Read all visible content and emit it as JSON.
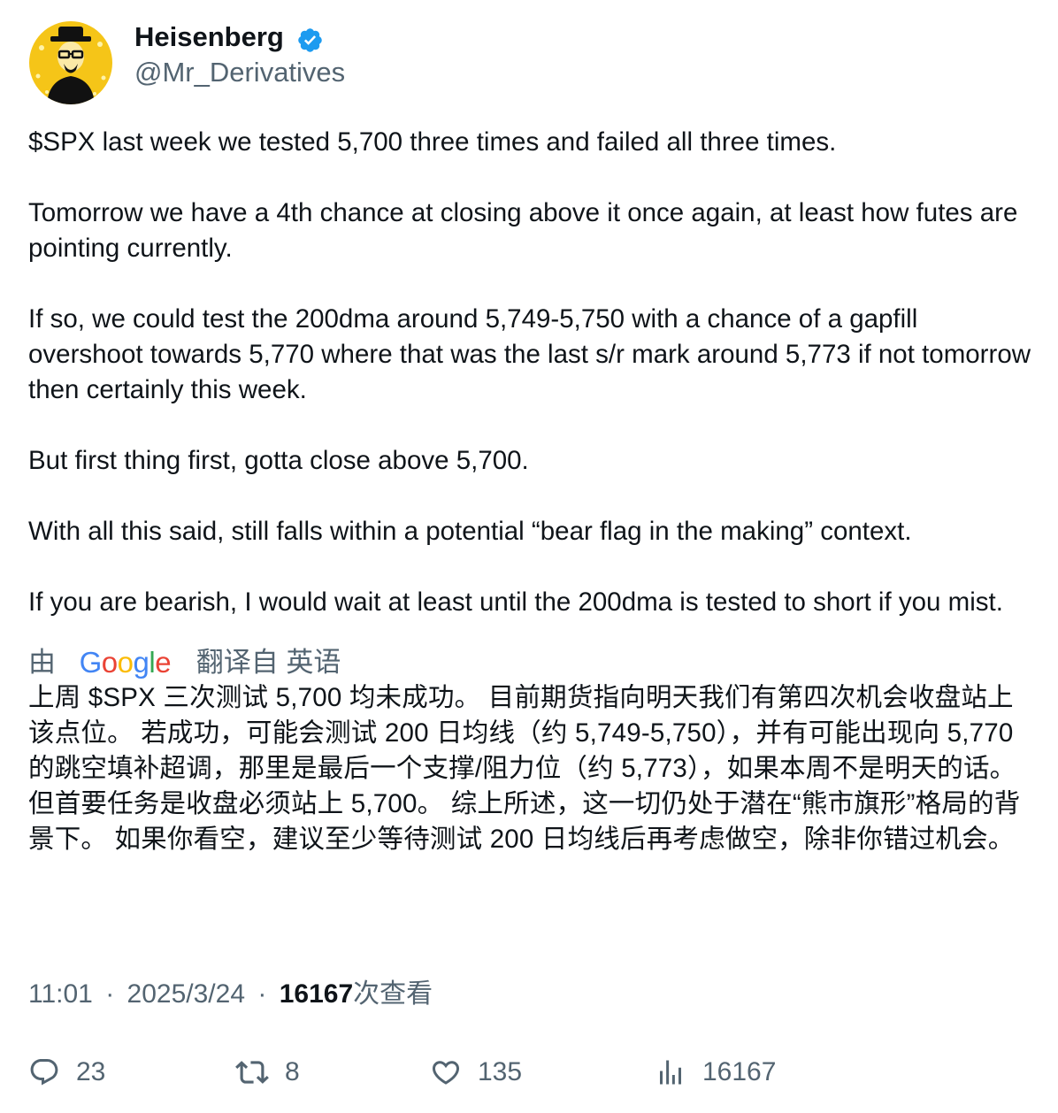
{
  "author": {
    "display_name": "Heisenberg",
    "handle": "@Mr_Derivatives",
    "verified": true,
    "verified_color": "#1d9bf0",
    "avatar_colors": {
      "background": "#f5c518",
      "figure": "#111111"
    }
  },
  "tweet": {
    "paragraphs": [
      "$SPX last week we tested 5,700 three times and failed all three times.",
      "Tomorrow we have a 4th chance at closing above it once again, at least how futes are pointing currently.",
      "If so, we could test the 200dma around 5,749-5,750 with a chance of a gapfill overshoot towards 5,770 where that was the last s/r mark around 5,773 if not tomorrow then certainly this week.",
      "But first thing first, gotta close above 5,700.",
      "With all this said, still falls within a potential “bear flag in the making” context.",
      "If you are bearish, I would wait at least until the 200dma is tested to short if you mist."
    ]
  },
  "translation": {
    "by_label": "由",
    "provider": "Google",
    "translated_from_label": "翻译自 英语",
    "text": "上周 $SPX 三次测试 5,700 均未成功。 目前期货指向明天我们有第四次机会收盘站上该点位。 若成功，可能会测试 200 日均线（约 5,749-5,750），并有可能出现向 5,770 的跳空填补超调，那里是最后一个支撑/阻力位（约 5,773），如果本周不是明天的话。 但首要任务是收盘必须站上 5,700。 综上所述，这一切仍处于潜在“熊市旗形”格局的背景下。 如果你看空，建议至少等待测试 200 日均线后再考虑做空，除非你错过机会。"
  },
  "meta": {
    "time": "11:01",
    "separator": "·",
    "date": "2025/3/24",
    "views_count": "16167",
    "views_label": "次查看"
  },
  "actions": {
    "replies": "23",
    "reposts": "8",
    "likes": "135",
    "views": "16167"
  },
  "icons": {
    "reply": "reply-icon",
    "repost": "repost-icon",
    "like": "heart-icon",
    "views": "analytics-icon",
    "verified": "verified-badge-icon"
  }
}
